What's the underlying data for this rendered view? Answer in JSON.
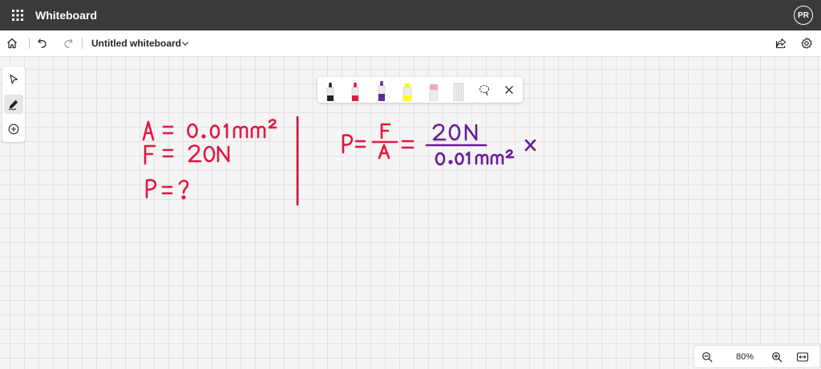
{
  "app": {
    "name": "Whiteboard",
    "user_initials": "PR"
  },
  "document": {
    "title": "Untitled whiteboard"
  },
  "pens": [
    {
      "name": "black",
      "color": "#252423"
    },
    {
      "name": "red",
      "color": "#e3173e"
    },
    {
      "name": "purple",
      "color": "#5c2d91"
    },
    {
      "name": "yellow-highlighter",
      "color": "#ffff00"
    },
    {
      "name": "pink-eraser",
      "color": "#f4a6b8"
    },
    {
      "name": "ruler",
      "color": "#c8c6c4"
    }
  ],
  "ink": {
    "red": "#e3173e",
    "purple": "#6a1b9a",
    "divider": "#d0103a"
  },
  "zoom": {
    "level": "80%"
  }
}
